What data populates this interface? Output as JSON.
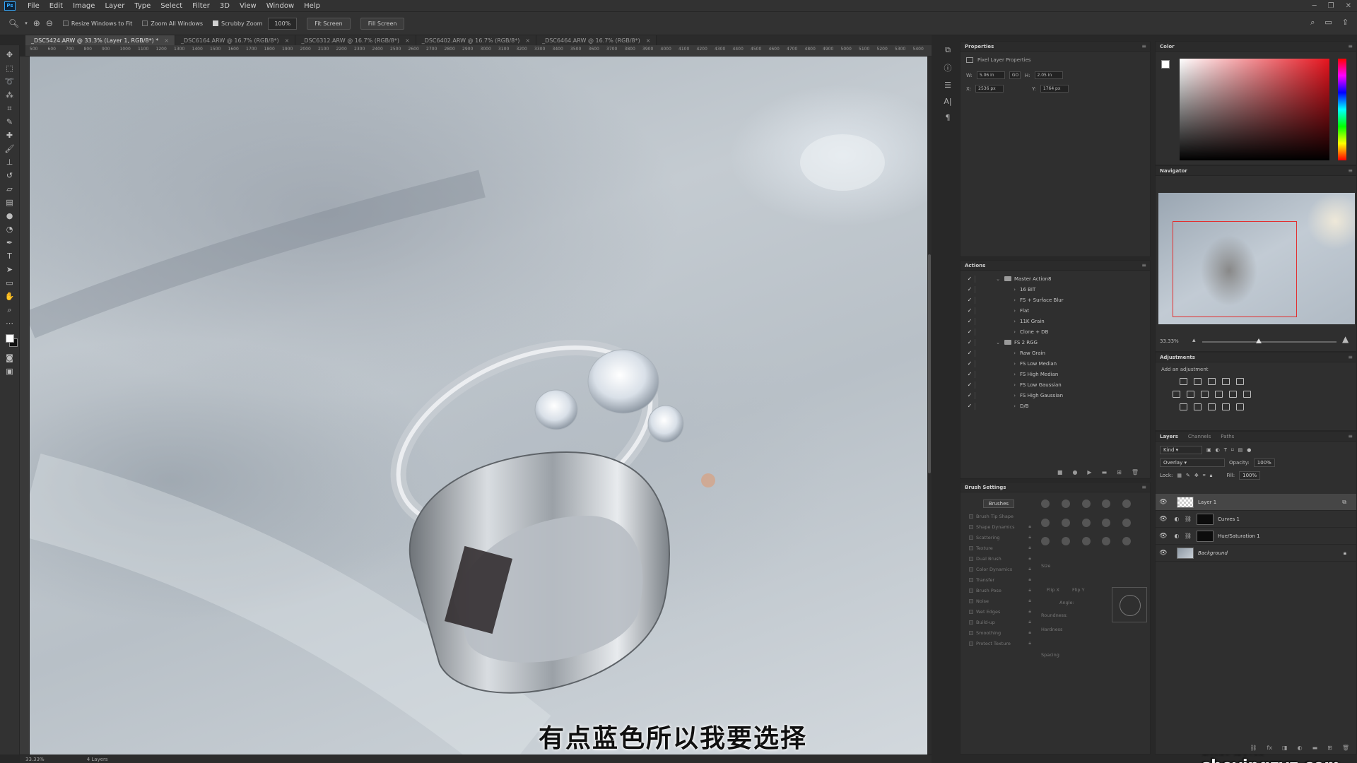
{
  "menubar": {
    "logo": "Ps",
    "items": [
      "File",
      "Edit",
      "Image",
      "Layer",
      "Type",
      "Select",
      "Filter",
      "3D",
      "View",
      "Window",
      "Help"
    ]
  },
  "options": {
    "resize_windows": "Resize Windows to Fit",
    "zoom_all": "Zoom All Windows",
    "scrubby": "Scrubby Zoom",
    "zoom_value": "100%",
    "fit_screen": "Fit Screen",
    "fill_screen": "Fill Screen"
  },
  "tabs": [
    {
      "label": "_DSC5424.ARW @ 33.3% (Layer 1, RGB/8*) *"
    },
    {
      "label": "_DSC6164.ARW @ 16.7% (RGB/8*)"
    },
    {
      "label": "_DSC6312.ARW @ 16.7% (RGB/8*)"
    },
    {
      "label": "_DSC6402.ARW @ 16.7% (RGB/8*)"
    },
    {
      "label": "_DSC6464.ARW @ 16.7% (RGB/8*)"
    }
  ],
  "ruler_ticks": [
    "500",
    "600",
    "700",
    "800",
    "900",
    "1000",
    "1100",
    "1200",
    "1300",
    "1400",
    "1500",
    "1600",
    "1700",
    "1800",
    "1900",
    "2000",
    "2100",
    "2200",
    "2300",
    "2400",
    "2500",
    "2600",
    "2700",
    "2800",
    "2900",
    "3000",
    "3100",
    "3200",
    "3300",
    "3400",
    "3500",
    "3600",
    "3700",
    "3800",
    "3900",
    "4000",
    "4100",
    "4200",
    "4300",
    "4400",
    "4500",
    "4600",
    "4700",
    "4800",
    "4900",
    "5000",
    "5100",
    "5200",
    "5300",
    "5400"
  ],
  "subtitle": "有点蓝色所以我要选择",
  "watermark": "摄影前沿 sheyingzyz.com",
  "status": {
    "zoom": "33.33%",
    "info": "4 Layers"
  },
  "properties": {
    "title": "Properties",
    "subtitle": "Pixel Layer Properties",
    "w_label": "W:",
    "w_value": "5.06 in",
    "link": "GO",
    "h_label": "H:",
    "h_value": "2.05 in",
    "x_label": "X:",
    "x_value": "2536 px",
    "y_label": "Y:",
    "y_value": "1764 px"
  },
  "actions": {
    "title": "Actions",
    "items": [
      {
        "label": "Master Action8",
        "type": "folder"
      },
      {
        "label": "16 BIT",
        "type": "action"
      },
      {
        "label": "FS + Surface Blur",
        "type": "action"
      },
      {
        "label": "Flat",
        "type": "action"
      },
      {
        "label": "11K Grain",
        "type": "action"
      },
      {
        "label": "Clone + DB",
        "type": "action"
      },
      {
        "label": "FS 2 RGG",
        "type": "folder"
      },
      {
        "label": "Raw Grain",
        "type": "action"
      },
      {
        "label": "FS Low Median",
        "type": "action"
      },
      {
        "label": "FS High Median",
        "type": "action"
      },
      {
        "label": "FS Low Gaussian",
        "type": "action"
      },
      {
        "label": "FS High Gaussian",
        "type": "action"
      },
      {
        "label": "D/B",
        "type": "action"
      }
    ]
  },
  "brush_settings": {
    "title": "Brush Settings",
    "brushes_button": "Brushes",
    "items": [
      "Brush Tip Shape",
      "Shape Dynamics",
      "Scattering",
      "Texture",
      "Dual Brush",
      "Color Dynamics",
      "Transfer",
      "Brush Pose",
      "Noise",
      "Wet Edges",
      "Build-up",
      "Smoothing",
      "Protect Texture"
    ],
    "size_label": "Size",
    "flip_x": "Flip X",
    "flip_y": "Flip Y",
    "angle_label": "Angle:",
    "roundness_label": "Roundness:",
    "hardness_label": "Hardness",
    "spacing_label": "Spacing"
  },
  "color": {
    "title": "Color",
    "fg": "#ffffff",
    "bg": "#111111"
  },
  "navigator": {
    "title": "Navigator",
    "zoom": "33.33%"
  },
  "adjustments": {
    "title": "Adjustments",
    "subtitle": "Add an adjustment"
  },
  "layers": {
    "tabs": [
      "Layers",
      "Channels",
      "Paths"
    ],
    "kind": "Kind",
    "blend_mode": "Overlay",
    "opacity_label": "Opacity:",
    "opacity": "100%",
    "lock_label": "Lock:",
    "fill_label": "Fill:",
    "fill": "100%",
    "items": [
      {
        "name": "Layer 1",
        "thumb": "trans",
        "selected": true
      },
      {
        "name": "Curves 1",
        "thumb": "black",
        "adjust": true
      },
      {
        "name": "Hue/Saturation 1",
        "thumb": "black",
        "adjust": true
      },
      {
        "name": "Background",
        "thumb": "photo",
        "locked": true
      }
    ]
  }
}
